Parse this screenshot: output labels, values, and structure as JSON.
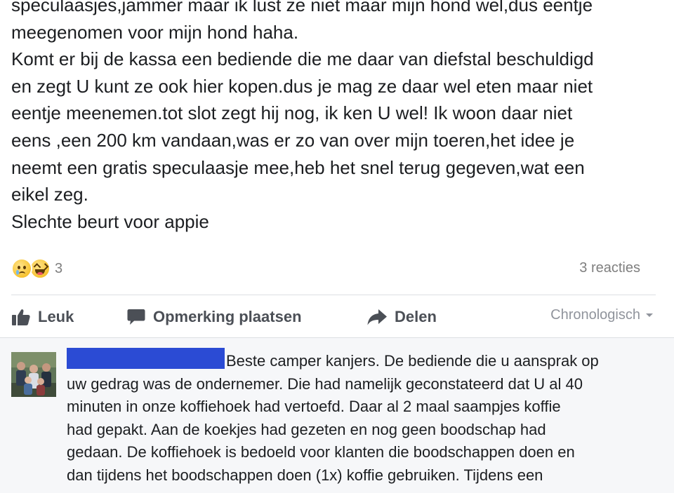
{
  "post": {
    "lines": [
      "speculaasjes,jammer maar ik lust ze niet maar mijn hond wel,dus eentje",
      "meegenomen voor mijn hond haha.",
      "Komt er bij de kassa een bediende die me daar van diefstal beschuldigd",
      "en zegt U kunt ze ook hier kopen.dus je mag ze daar wel eten maar niet",
      "eentje meenemen.tot slot zegt hij nog, ik ken U wel! Ik woon daar niet",
      "eens ,een 200 km vandaan,was er zo van over mijn toeren,het idee je",
      "neemt een gratis speculaasje mee,heb het snel terug gegeven,wat een",
      "eikel zeg.",
      "Slechte beurt voor appie"
    ]
  },
  "reactions": {
    "icons": [
      "sad-emoji-icon",
      "haha-emoji-icon"
    ],
    "count": "3",
    "comments_label": "3 reacties"
  },
  "actions": {
    "like_label": "Leuk",
    "comment_label": "Opmerking plaatsen",
    "share_label": "Delen",
    "sort_label": "Chronologisch"
  },
  "comment": {
    "lines": [
      "Beste camper kanjers. De bediende die u aansprak op",
      "uw gedrag was de ondernemer. Die had namelijk geconstateerd dat U al 40",
      "minuten in onze koffiehoek had vertoefd. Daar al 2 maal saampjes koffie",
      "had gepakt. Aan de koekjes had gezeten en nog geen boodschap had",
      "gedaan. De koffiehoek is bedoeld voor klanten die boodschappen doen en",
      "dan tijdens het boodschappen doen (1x) koffie gebruiken. Tijdens een"
    ]
  },
  "colors": {
    "action_text": "#4b4f56",
    "meta_text": "#90949c",
    "redaction": "#2b4bd4",
    "comments_bg": "#f6f7f9"
  }
}
